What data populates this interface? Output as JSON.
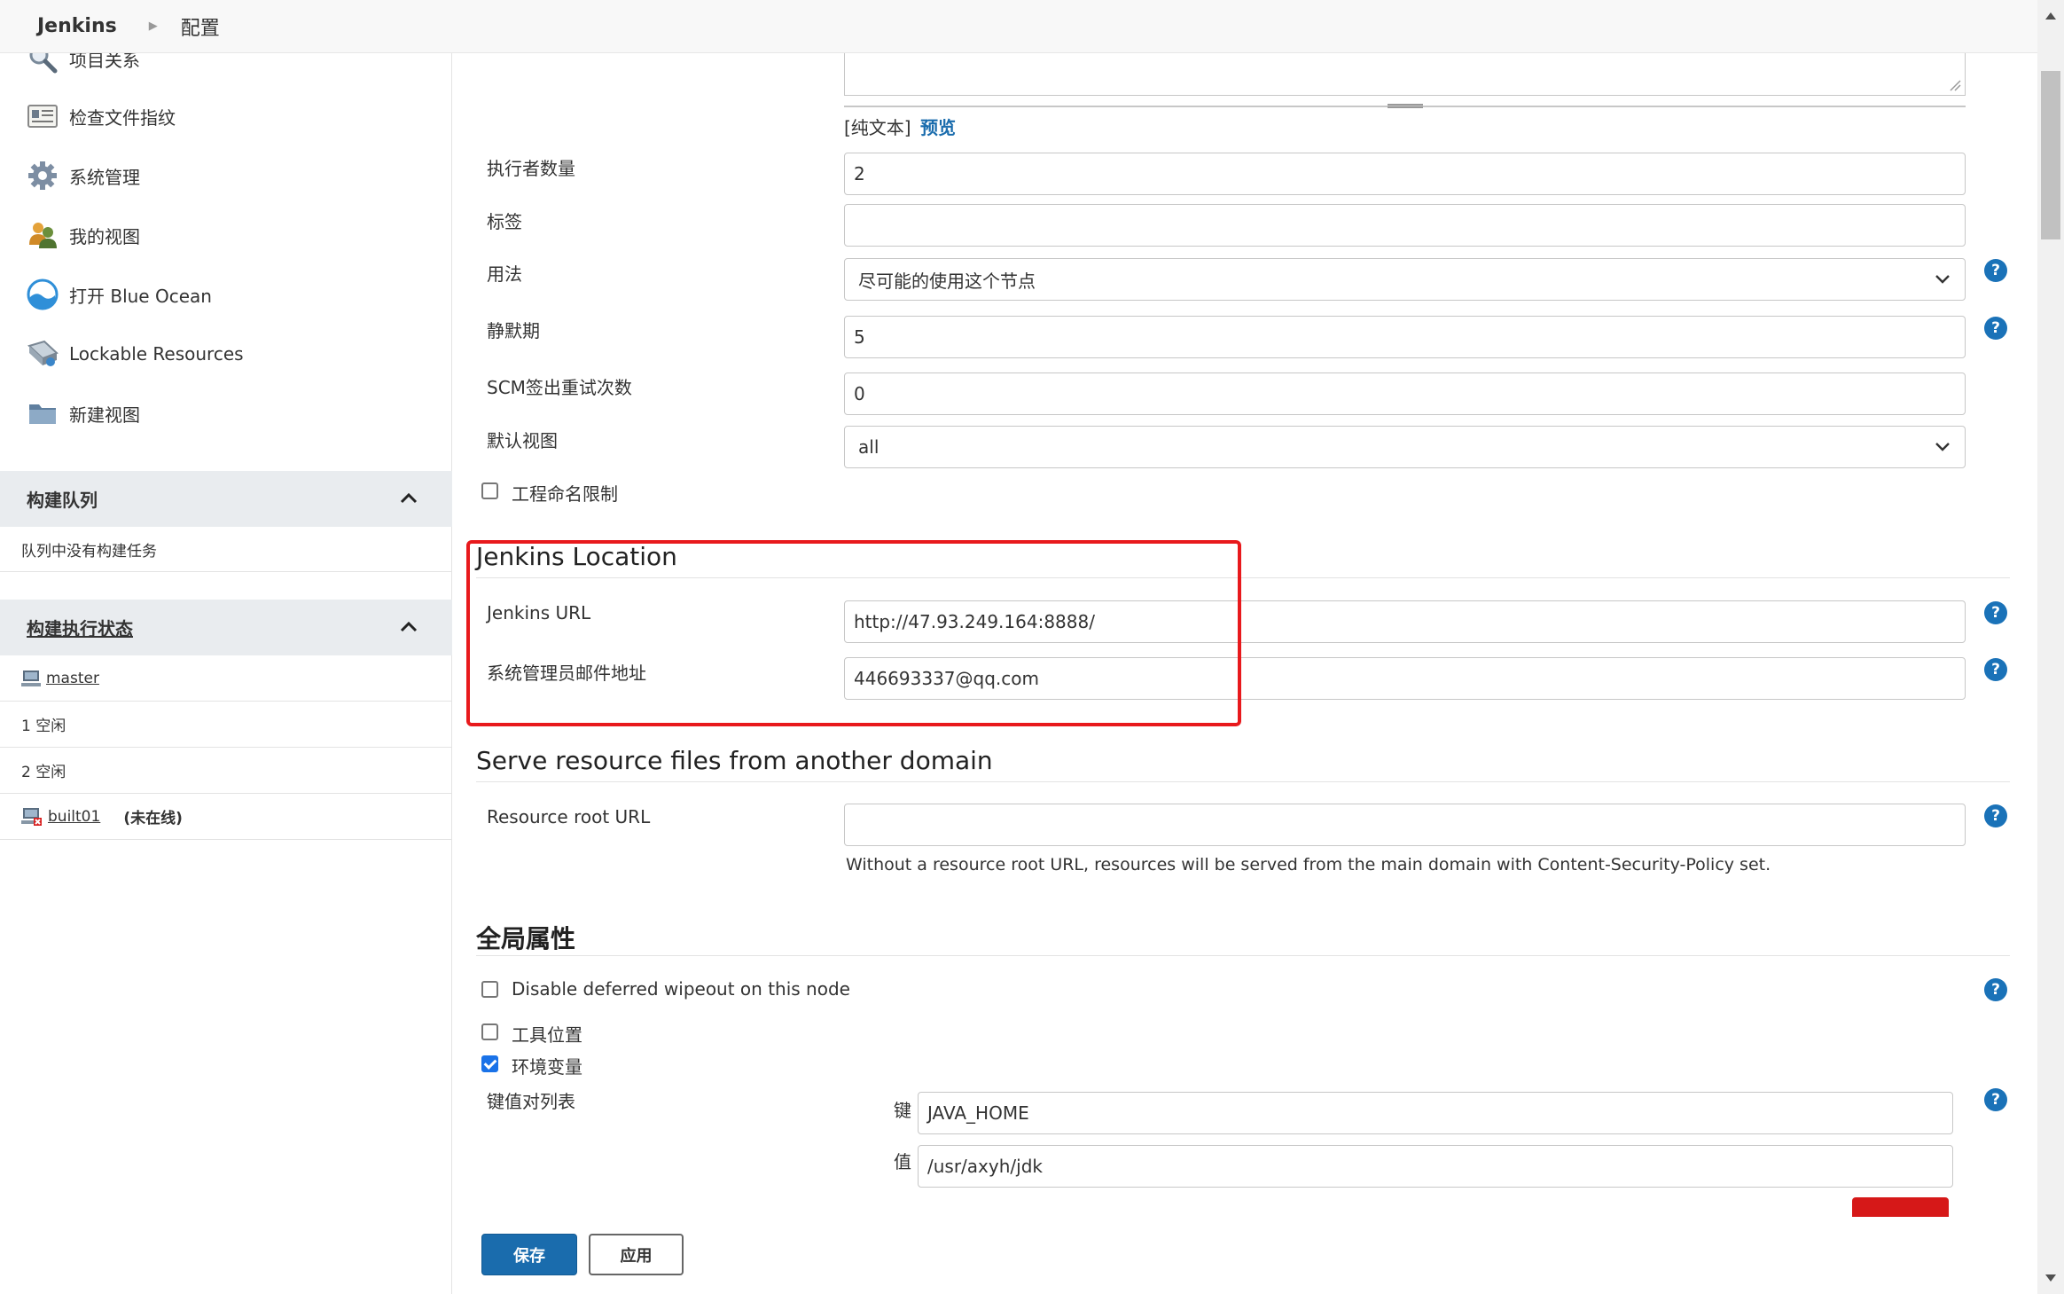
{
  "breadcrumb": {
    "home": "Jenkins",
    "current": "配置"
  },
  "sidebar": {
    "tasks": [
      {
        "label": "项目关系",
        "icon": "search-icon"
      },
      {
        "label": "检查文件指纹",
        "icon": "fingerprint-icon"
      },
      {
        "label": "系统管理",
        "icon": "gear-icon"
      },
      {
        "label": "我的视图",
        "icon": "users-icon"
      },
      {
        "label": "打开 Blue Ocean",
        "icon": "blue-ocean-icon"
      },
      {
        "label": "Lockable Resources",
        "icon": "lock-resource-icon"
      },
      {
        "label": "新建视图",
        "icon": "folder-icon"
      }
    ],
    "build_queue": {
      "title": "构建队列",
      "empty_text": "队列中没有构建任务"
    },
    "executors": {
      "title": "构建执行状态",
      "master": "master",
      "executor_1": "1  空闲",
      "executor_2": "2  空闲",
      "built01": "built01",
      "built01_status": "(未在线)"
    }
  },
  "form": {
    "plain_text": "[纯文本]",
    "preview": "预览",
    "executors_label": "执行者数量",
    "executors_value": "2",
    "labels_label": "标签",
    "labels_value": "",
    "usage_label": "用法",
    "usage_value": "尽可能的使用这个节点",
    "quiet_label": "静默期",
    "quiet_value": "5",
    "scm_label": "SCM签出重试次数",
    "scm_value": "0",
    "default_view_label": "默认视图",
    "default_view_value": "all",
    "project_naming_label": "工程命名限制",
    "project_naming_checked": false,
    "jenkins_location": {
      "title": "Jenkins Location",
      "url_label": "Jenkins URL",
      "url_value": "http://47.93.249.164:8888/",
      "email_label": "系统管理员邮件地址",
      "email_value": "446693337@qq.com"
    },
    "serve_resource": {
      "title": "Serve resource files from another domain",
      "url_label": "Resource root URL",
      "url_value": "",
      "hint": "Without a resource root URL, resources will be served from the main domain with Content-Security-Policy set."
    },
    "global_properties": {
      "title": "全局属性",
      "disable_wipeout": "Disable deferred wipeout on this node",
      "disable_wipeout_checked": false,
      "tool_locations": "工具位置",
      "tool_locations_checked": false,
      "env_vars": "环境变量",
      "env_vars_checked": true,
      "kv_list_label": "键值对列表",
      "key_label": "键",
      "key_value": "JAVA_HOME",
      "value_label": "值",
      "value_value": "/usr/axyh/jdk"
    }
  },
  "buttons": {
    "save": "保存",
    "apply": "应用"
  },
  "colors": {
    "accent": "#1a72b8",
    "highlight": "#e8191c",
    "save_button": "#1a6cad",
    "delete_button": "#d61818"
  }
}
